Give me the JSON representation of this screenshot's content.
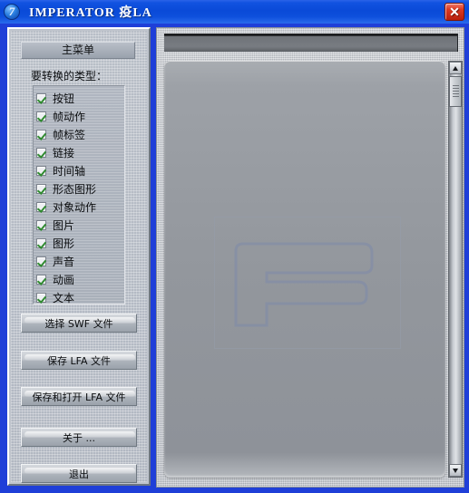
{
  "window": {
    "title": "IMPERATOR 疫LA",
    "icon": "app-globe-icon",
    "close_label": "✕"
  },
  "left_panel": {
    "menu_title": "主菜单",
    "types_label": "要转换的类型：",
    "checkbox_items": [
      {
        "label": "按钮",
        "checked": true
      },
      {
        "label": "帧动作",
        "checked": true
      },
      {
        "label": "帧标签",
        "checked": true
      },
      {
        "label": "链接",
        "checked": true
      },
      {
        "label": "时间轴",
        "checked": true
      },
      {
        "label": "形态图形",
        "checked": true
      },
      {
        "label": "对象动作",
        "checked": true
      },
      {
        "label": "图片",
        "checked": true
      },
      {
        "label": "图形",
        "checked": true
      },
      {
        "label": "声音",
        "checked": true
      },
      {
        "label": "动画",
        "checked": true
      },
      {
        "label": "文本",
        "checked": true
      }
    ],
    "buttons": {
      "select_swf": "选择 SWF 文件",
      "save_lfa": "保存 LFA 文件",
      "save_and_open_lfa": "保存和打开 LFA 文件",
      "about": "关于 ...",
      "exit": "退出"
    }
  },
  "right_panel": {
    "logo_letter": "F",
    "scrollbar": {
      "up_arrow": "▲",
      "down_arrow": "▼"
    }
  },
  "colors": {
    "titlebar_blue": "#0a4ad8",
    "close_red": "#dc3a22",
    "panel_gray": "#b8bec7",
    "stage_gray": "#93979d",
    "check_green": "#2f8a2f",
    "logo_blue": "#7f8ba8"
  }
}
